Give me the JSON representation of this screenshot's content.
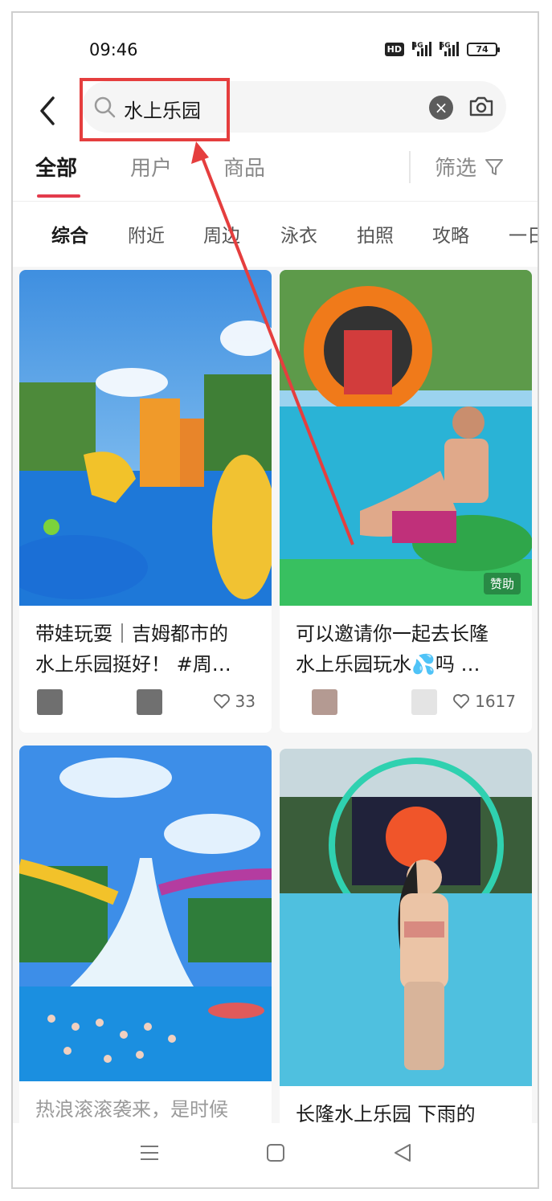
{
  "status_bar": {
    "time": "09:46",
    "hd_label": "HD",
    "net1_label": "4G",
    "net2_label": "5G",
    "battery": "74"
  },
  "search": {
    "query": "水上乐园"
  },
  "tabs": [
    {
      "label": "全部",
      "active": true
    },
    {
      "label": "用户",
      "active": false
    },
    {
      "label": "商品",
      "active": false
    }
  ],
  "filter_label": "筛选",
  "subtabs": [
    {
      "label": "综合",
      "active": true
    },
    {
      "label": "附近",
      "active": false
    },
    {
      "label": "周边",
      "active": false
    },
    {
      "label": "泳衣",
      "active": false
    },
    {
      "label": "拍照",
      "active": false
    },
    {
      "label": "攻略",
      "active": false
    },
    {
      "label": "一日",
      "active": false
    }
  ],
  "cards": [
    {
      "title_line1": "带娃玩耍｜吉姆都市的",
      "title_line2": "水上乐园挺好！ #周…",
      "likes": "33"
    },
    {
      "title_line1": "可以邀请你一起去长隆",
      "title_line2": "水上乐园玩水💦吗 …",
      "likes": "1617",
      "sponsor": "赞助"
    },
    {
      "title_line1": "热浪滚滚袭来，是时候",
      "title_line2": ""
    },
    {
      "title_line1": "长隆水上乐园 下雨的",
      "title_line2": ""
    }
  ],
  "colors": {
    "accent": "#e33b4c",
    "highlight": "#e53e3e"
  }
}
